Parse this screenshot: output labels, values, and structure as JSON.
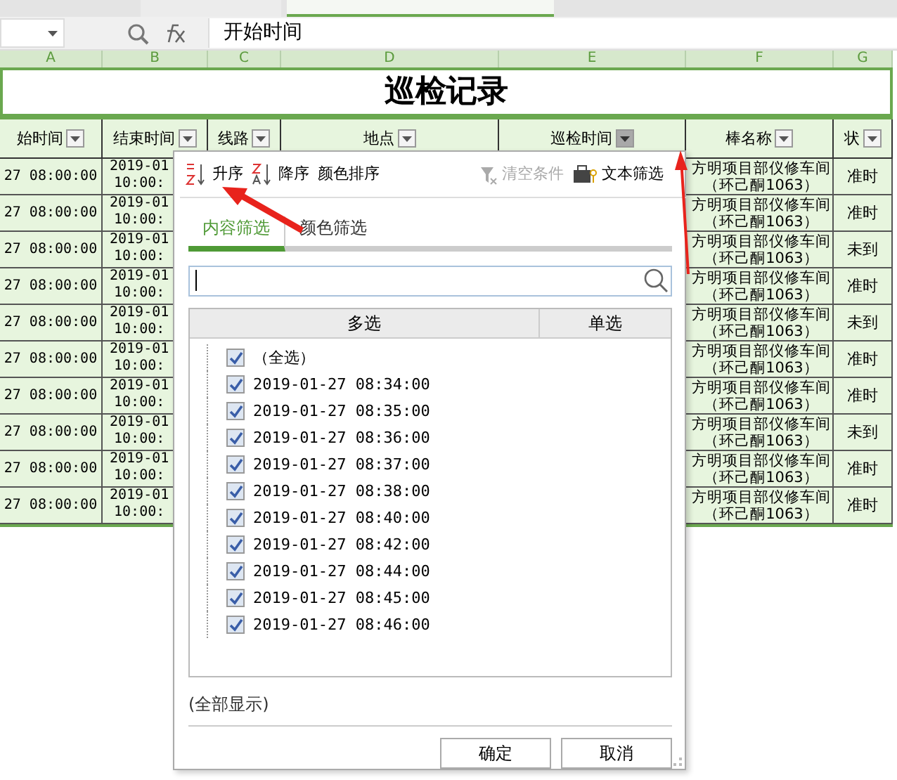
{
  "formula_bar": {
    "formula": "开始时间"
  },
  "column_letters": [
    "A",
    "B",
    "C",
    "D",
    "E",
    "F",
    "G"
  ],
  "sheet_title": "巡检记录",
  "headers": [
    {
      "label": "始时间",
      "filter_active": false
    },
    {
      "label": "结束时间",
      "filter_active": false
    },
    {
      "label": "线路",
      "filter_active": false
    },
    {
      "label": "地点",
      "filter_active": false
    },
    {
      "label": "巡检时间",
      "filter_active": true
    },
    {
      "label": "棒名称",
      "filter_active": false
    },
    {
      "label": "状",
      "filter_active": false
    }
  ],
  "rows": [
    {
      "start": "27 08:00:00",
      "end": "2019-01\n10:00:",
      "post": "方明项目部仪修车间（环己酮1063）",
      "status": "准时"
    },
    {
      "start": "27 08:00:00",
      "end": "2019-01\n10:00:",
      "post": "方明项目部仪修车间（环己酮1063）",
      "status": "准时"
    },
    {
      "start": "27 08:00:00",
      "end": "2019-01\n10:00:",
      "post": "方明项目部仪修车间（环己酮1063）",
      "status": "未到"
    },
    {
      "start": "27 08:00:00",
      "end": "2019-01\n10:00:",
      "post": "方明项目部仪修车间（环己酮1063）",
      "status": "准时"
    },
    {
      "start": "27 08:00:00",
      "end": "2019-01\n10:00:",
      "post": "方明项目部仪修车间（环己酮1063）",
      "status": "未到"
    },
    {
      "start": "27 08:00:00",
      "end": "2019-01\n10:00:",
      "post": "方明项目部仪修车间（环己酮1063）",
      "status": "准时"
    },
    {
      "start": "27 08:00:00",
      "end": "2019-01\n10:00:",
      "post": "方明项目部仪修车间（环己酮1063）",
      "status": "准时"
    },
    {
      "start": "27 08:00:00",
      "end": "2019-01\n10:00:",
      "post": "方明项目部仪修车间（环己酮1063）",
      "status": "未到"
    },
    {
      "start": "27 08:00:00",
      "end": "2019-01\n10:00:",
      "post": "方明项目部仪修车间（环己酮1063）",
      "status": "准时"
    },
    {
      "start": "27 08:00:00",
      "end": "2019-01\n10:00:",
      "post": "方明项目部仪修车间（环己酮1063）",
      "status": "准时"
    }
  ],
  "filter_dialog": {
    "sort_buttons": [
      {
        "kind": "asc",
        "label": "升序"
      },
      {
        "kind": "desc",
        "label": "降序"
      },
      {
        "kind": "color",
        "label": "颜色排序"
      }
    ],
    "tools": [
      {
        "kind": "clear",
        "label": "清空条件",
        "disabled": true
      },
      {
        "kind": "text",
        "label": "文本筛选",
        "disabled": false
      }
    ],
    "tabs": [
      {
        "label": "内容筛选",
        "selected": true
      },
      {
        "label": "颜色筛选",
        "selected": false
      }
    ],
    "list_columns": [
      "多选",
      "单选"
    ],
    "items": [
      {
        "label": "（全选）",
        "checked": true
      },
      {
        "label": "2019-01-27 08:34:00",
        "checked": true
      },
      {
        "label": "2019-01-27 08:35:00",
        "checked": true
      },
      {
        "label": "2019-01-27 08:36:00",
        "checked": true
      },
      {
        "label": "2019-01-27 08:37:00",
        "checked": true
      },
      {
        "label": "2019-01-27 08:38:00",
        "checked": true
      },
      {
        "label": "2019-01-27 08:40:00",
        "checked": true
      },
      {
        "label": "2019-01-27 08:42:00",
        "checked": true
      },
      {
        "label": "2019-01-27 08:44:00",
        "checked": true
      },
      {
        "label": "2019-01-27 08:45:00",
        "checked": true
      },
      {
        "label": "2019-01-27 08:46:00",
        "checked": true
      }
    ],
    "footer": "(全部显示)",
    "buttons": [
      "确定",
      "取消"
    ]
  }
}
